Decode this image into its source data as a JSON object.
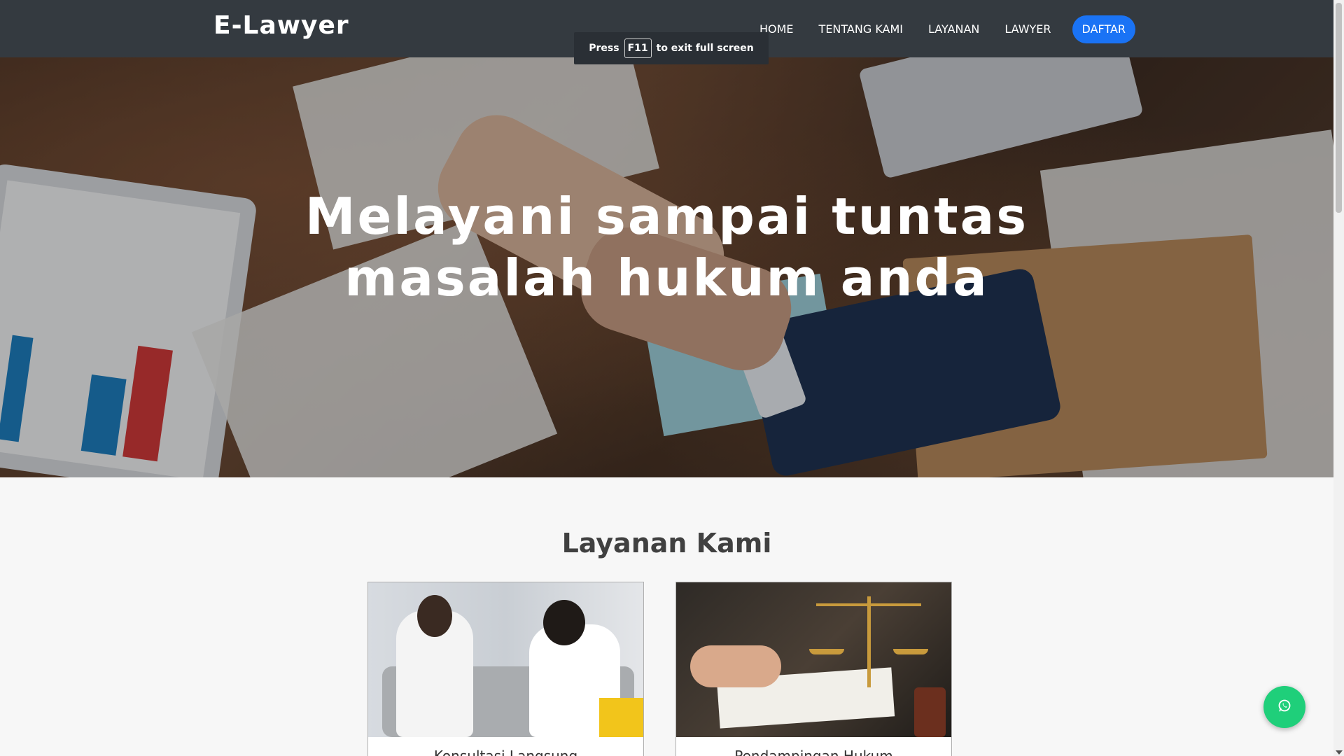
{
  "navbar": {
    "brand": "E-Lawyer",
    "links": [
      "HOME",
      "TENTANG KAMI",
      "LAYANAN",
      "LAWYER"
    ],
    "cta": "DAFTAR"
  },
  "fullscreen_toast": {
    "before": "Press",
    "key": "F11",
    "after": "to exit full screen"
  },
  "hero": {
    "title_line1": "Melayani sampai tuntas",
    "title_line2": "masalah hukum anda"
  },
  "services": {
    "title": "Layanan Kami",
    "items": [
      {
        "label": "Konsultasi Langsung",
        "image": "consultation-photo"
      },
      {
        "label": "Pendampingan Hukum",
        "image": "legal-scales-photo"
      }
    ]
  },
  "whatsapp": {
    "icon": "whatsapp-icon",
    "color": "#1fcf7a"
  },
  "colors": {
    "navbar": "#343a40",
    "accent": "#1a73f5"
  }
}
